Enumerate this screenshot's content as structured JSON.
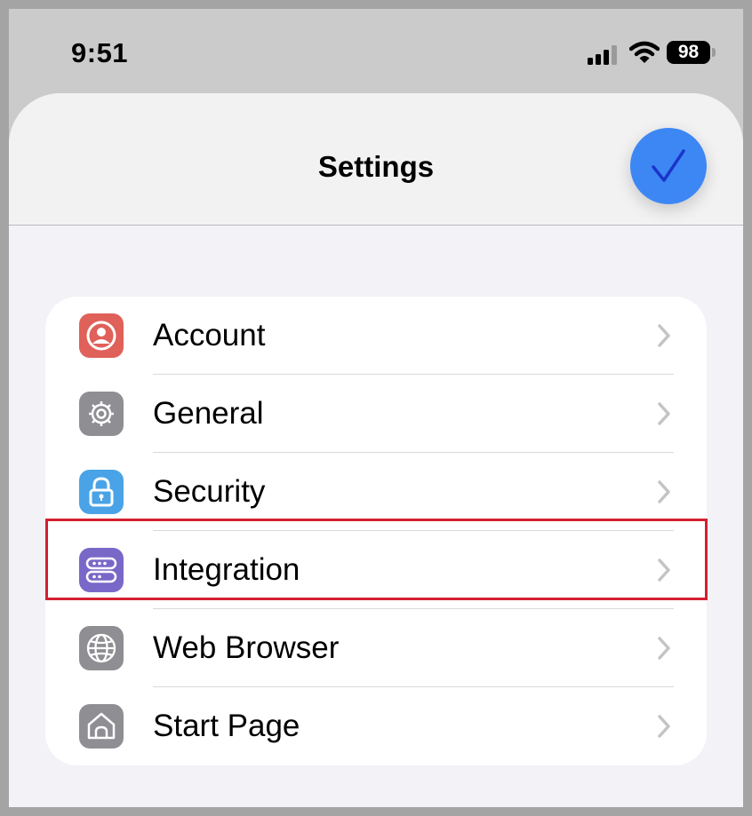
{
  "status_bar": {
    "time": "9:51",
    "battery_level": "98",
    "icons": [
      "signal-icon",
      "wifi-icon",
      "battery-icon"
    ]
  },
  "sheet": {
    "title": "Settings",
    "done_icon": "checkmark-icon",
    "accent_color": "#3d87f5"
  },
  "settings": {
    "items": [
      {
        "label": "Account",
        "icon": "person-circle-icon",
        "icon_color": "#e0605a"
      },
      {
        "label": "General",
        "icon": "gear-icon",
        "icon_color": "#8e8e93"
      },
      {
        "label": "Security",
        "icon": "lock-icon",
        "icon_color": "#4aa3e6"
      },
      {
        "label": "Integration",
        "icon": "integration-icon",
        "icon_color": "#7a68c8",
        "highlighted": true
      },
      {
        "label": "Web Browser",
        "icon": "globe-icon",
        "icon_color": "#8e8e93"
      },
      {
        "label": "Start Page",
        "icon": "home-icon",
        "icon_color": "#8e8e93"
      }
    ]
  },
  "highlight_color": "#d32030"
}
